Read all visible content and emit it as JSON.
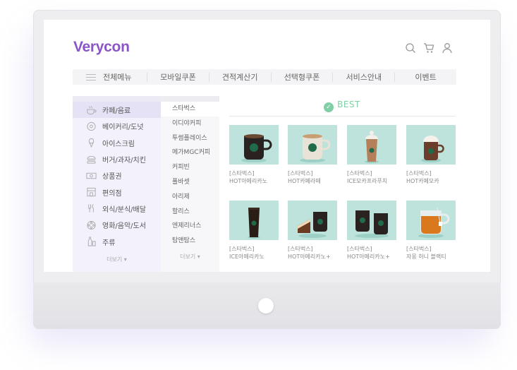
{
  "brand": {
    "logo": "Verycon"
  },
  "nav": {
    "menu_all": "전체메뉴",
    "items": [
      "모바일쿠폰",
      "견적계산기",
      "선택형쿠폰",
      "서비스안내",
      "이벤트"
    ]
  },
  "categories": {
    "items": [
      {
        "label": "카페/음료",
        "icon": "coffee-cup-icon"
      },
      {
        "label": "베이커리/도넛",
        "icon": "donut-icon"
      },
      {
        "label": "아이스크림",
        "icon": "ice-cream-icon"
      },
      {
        "label": "버거/과자/치킨",
        "icon": "burger-icon"
      },
      {
        "label": "상품권",
        "icon": "voucher-icon"
      },
      {
        "label": "편의점",
        "icon": "store-icon"
      },
      {
        "label": "외식/분식/배달",
        "icon": "utensils-icon"
      },
      {
        "label": "영화/음악/도서",
        "icon": "film-reel-icon"
      },
      {
        "label": "주류",
        "icon": "bottle-icon"
      }
    ],
    "more": "더보기 ▾"
  },
  "brands": {
    "items": [
      "스타벅스",
      "이디야커피",
      "투썸플레이스",
      "메가MGC커피",
      "커피빈",
      "폴바셋",
      "아리제",
      "할리스",
      "엔제리너스",
      "탐앤탐스"
    ],
    "more": "더보기 ▾"
  },
  "best": {
    "title": "BEST",
    "products": [
      {
        "brand": "[스타벅스]",
        "name": "HOT아메리카노"
      },
      {
        "brand": "[스타벅스]",
        "name": "HOT카페라떼"
      },
      {
        "brand": "[스타벅스]",
        "name": "ICE모카프라푸치"
      },
      {
        "brand": "[스타벅스]",
        "name": "HOT카페모카"
      },
      {
        "brand": "[스타벅스]",
        "name": "ICE아메리카노"
      },
      {
        "brand": "[스타벅스]",
        "name": "HOT아메리카노+"
      },
      {
        "brand": "[스타벅스]",
        "name": "HOT아메리카노+"
      },
      {
        "brand": "[스타벅스]",
        "name": "자몽 허니 블랙티"
      }
    ]
  },
  "colors": {
    "accent": "#8b55c8",
    "best_green": "#80cfa6",
    "thumb_bg": "#bde3dc"
  }
}
